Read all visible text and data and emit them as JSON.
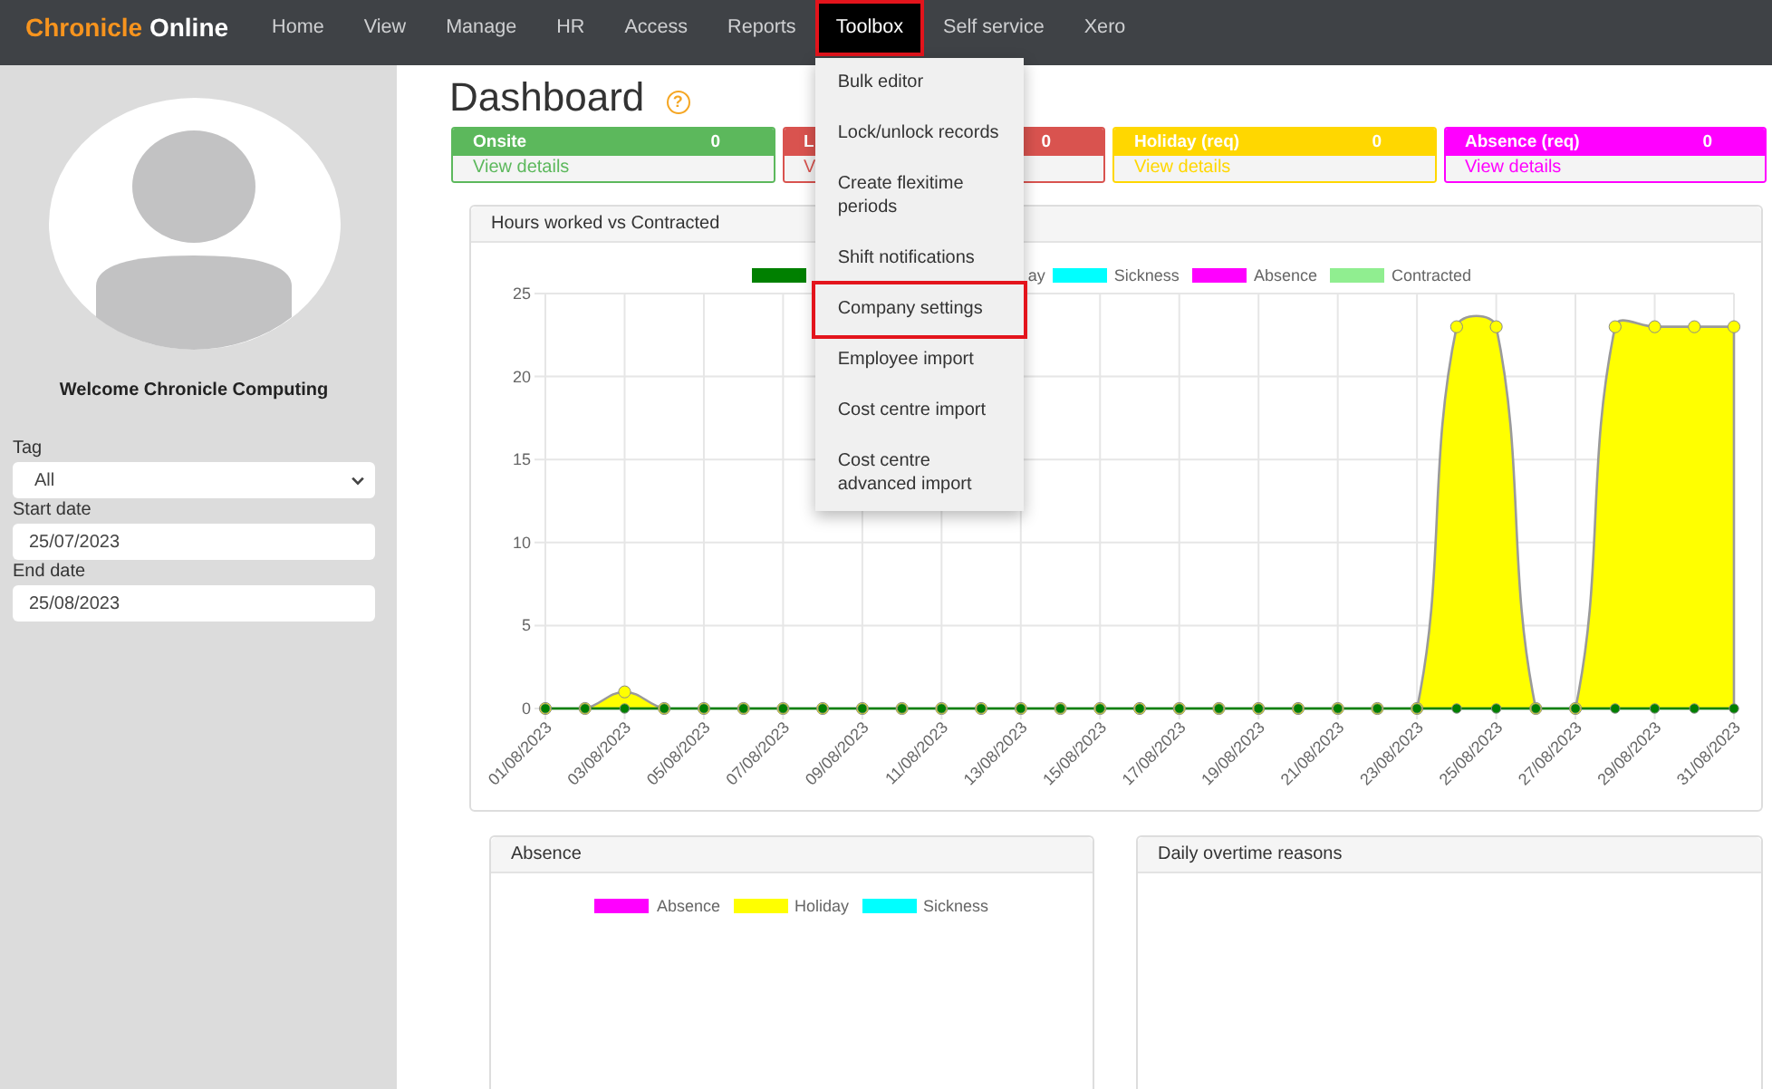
{
  "nav": {
    "logo": {
      "primary": "Chronicle",
      "secondary": "Online"
    },
    "items": [
      {
        "label": "Home",
        "selected": false,
        "highlighted": false
      },
      {
        "label": "View",
        "selected": false,
        "highlighted": false
      },
      {
        "label": "Manage",
        "selected": false,
        "highlighted": false
      },
      {
        "label": "HR",
        "selected": false,
        "highlighted": false
      },
      {
        "label": "Access",
        "selected": false,
        "highlighted": false
      },
      {
        "label": "Reports",
        "selected": false,
        "highlighted": false
      },
      {
        "label": "Toolbox",
        "selected": true,
        "highlighted": true,
        "menu": [
          {
            "label": "Bulk editor",
            "highlighted": false
          },
          {
            "label": "Lock/unlock records",
            "highlighted": false
          },
          {
            "label": "Create flexitime periods",
            "highlighted": false
          },
          {
            "label": "Shift notifications",
            "highlighted": false
          },
          {
            "label": "Company settings",
            "highlighted": true
          },
          {
            "label": "Employee import",
            "highlighted": false
          },
          {
            "label": "Cost centre import",
            "highlighted": false
          },
          {
            "label": "Cost centre advanced import",
            "highlighted": false
          }
        ]
      },
      {
        "label": "Self service",
        "selected": false,
        "highlighted": false
      },
      {
        "label": "Xero",
        "selected": false,
        "highlighted": false
      }
    ]
  },
  "sidebar": {
    "welcome": "Welcome Chronicle Computing",
    "fields": [
      {
        "kind": "select",
        "label": "Tag",
        "value": "All"
      },
      {
        "kind": "date",
        "label": "Start date",
        "value": "25/07/2023"
      },
      {
        "kind": "date",
        "label": "End date",
        "value": "25/08/2023"
      }
    ]
  },
  "dashboard": {
    "title": "Dashboard",
    "help": "?",
    "cards": [
      {
        "label": "Onsite",
        "count": "0",
        "link": "View details",
        "color": "#5cb85c"
      },
      {
        "label": "L",
        "count": "0",
        "link": "V",
        "color": "#d9534f"
      },
      {
        "label": "Holiday (req)",
        "count": "0",
        "link": "View details",
        "color": "#ffd700"
      },
      {
        "label": "Absence (req)",
        "count": "0",
        "link": "View details",
        "color": "#ff00ff"
      }
    ]
  },
  "hours_chart": {
    "title": "Hours worked vs Contracted",
    "legend": [
      {
        "color": "#008000"
      },
      {
        "label": "ay"
      },
      {
        "label": "Sickness",
        "color": "#00ffff"
      },
      {
        "label": "Absence",
        "color": "#ff00ff"
      },
      {
        "label": "Contracted",
        "color": "#90ee90"
      }
    ],
    "chart_data": {
      "type": "area",
      "stacked": false,
      "grid": true,
      "categories": [
        "01/08/2023",
        null,
        "03/08/2023",
        null,
        "05/08/2023",
        null,
        "07/08/2023",
        null,
        "09/08/2023",
        null,
        "11/08/2023",
        null,
        "13/08/2023",
        null,
        "15/08/2023",
        null,
        "17/08/2023",
        null,
        "19/08/2023",
        null,
        "21/08/2023",
        null,
        "23/08/2023",
        null,
        "25/08/2023",
        null,
        "27/08/2023",
        null,
        "29/08/2023",
        null,
        "31/08/2023"
      ],
      "ylim": [
        0,
        25
      ],
      "yticks": [
        0,
        5,
        10,
        15,
        20,
        25
      ],
      "series": [
        {
          "color": "#ffff00",
          "marker": "circle",
          "values": [
            0,
            0,
            1,
            0,
            0,
            0,
            0,
            0,
            0,
            0,
            0,
            0,
            0,
            0,
            0,
            0,
            0,
            0,
            0,
            0,
            0,
            0,
            0,
            23,
            23,
            0,
            0,
            23,
            23,
            23,
            23
          ]
        },
        {
          "type": "line",
          "color": "#008000",
          "marker": "circle",
          "values": [
            0,
            0,
            0,
            0,
            0,
            0,
            0,
            0,
            0,
            0,
            0,
            0,
            0,
            0,
            0,
            0,
            0,
            0,
            0,
            0,
            0,
            0,
            0,
            0,
            0,
            0,
            0,
            0,
            0,
            0,
            0
          ]
        }
      ]
    }
  },
  "panels": [
    {
      "title": "Absence",
      "legend": [
        {
          "label": "Absence",
          "color": "#ff00ff"
        },
        {
          "label": "Holiday",
          "color": "#ffff00"
        },
        {
          "label": "Sickness",
          "color": "#00ffff"
        }
      ]
    },
    {
      "title": "Daily overtime reasons"
    }
  ]
}
